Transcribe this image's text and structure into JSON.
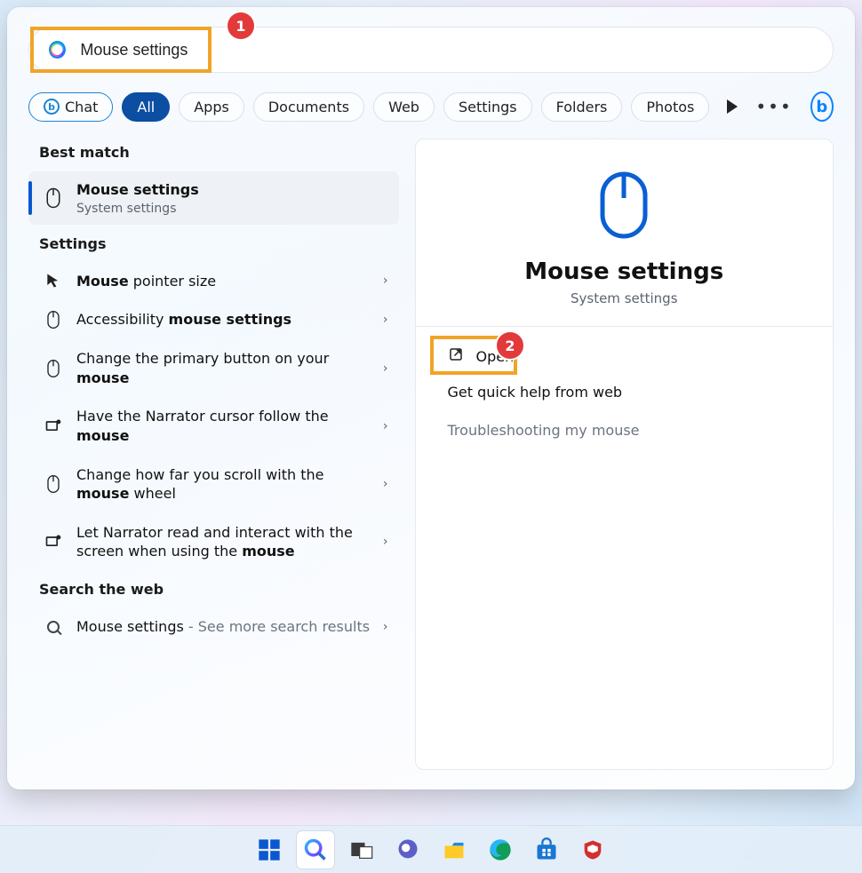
{
  "annotations": {
    "badge1": "1",
    "badge2": "2"
  },
  "search": {
    "value": "Mouse settings"
  },
  "filters": {
    "chat": "Chat",
    "items": [
      "All",
      "Apps",
      "Documents",
      "Web",
      "Settings",
      "Folders",
      "Photos"
    ],
    "active_index": 0
  },
  "left": {
    "best_match_header": "Best match",
    "best_match": {
      "title": "Mouse settings",
      "subtitle": "System settings"
    },
    "settings_header": "Settings",
    "settings_items": [
      {
        "pre": "",
        "bold": "Mouse",
        "post": " pointer size",
        "icon": "pointer-size-icon"
      },
      {
        "pre": "Accessibility ",
        "bold": "mouse settings",
        "post": "",
        "icon": "mouse-icon"
      },
      {
        "pre": "Change the primary button on your ",
        "bold": "mouse",
        "post": "",
        "icon": "mouse-icon"
      },
      {
        "pre": "Have the Narrator cursor follow the ",
        "bold": "mouse",
        "post": "",
        "icon": "narrator-icon"
      },
      {
        "pre": "Change how far you scroll with the ",
        "bold": "mouse",
        "post": " wheel",
        "icon": "mouse-icon"
      },
      {
        "pre": "Let Narrator read and interact with the screen when using the ",
        "bold": "mouse",
        "post": "",
        "icon": "narrator-icon"
      }
    ],
    "web_header": "Search the web",
    "web_item": {
      "title": "Mouse settings",
      "suffix": " - See more search results"
    }
  },
  "right": {
    "title": "Mouse settings",
    "subtitle": "System settings",
    "open_label": "Open",
    "help_label": "Get quick help from web",
    "troubleshoot_label": "Troubleshooting my mouse"
  },
  "taskbar": {
    "items": [
      "start",
      "search",
      "taskview",
      "chat",
      "explorer",
      "edge",
      "store",
      "mcafee"
    ],
    "active": "search"
  }
}
